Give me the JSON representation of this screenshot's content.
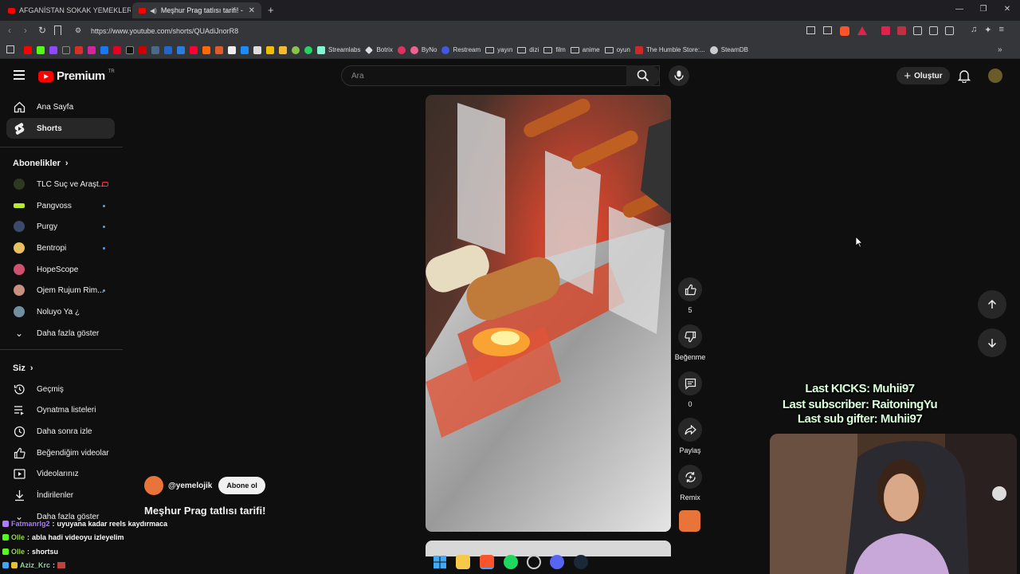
{
  "browser": {
    "tabs": [
      {
        "title": "AFGANİSTAN SOKAK YEMEKLERİNE"
      },
      {
        "title": "Meşhur Prag tatlısı tarifi! - Yo"
      }
    ],
    "new_tab": "+",
    "url": "https://www.youtube.com/shorts/QUAdiJnorR8",
    "bookmarks": [
      {
        "label": "Streamlabs",
        "type": "link"
      },
      {
        "label": "Botrix",
        "type": "link"
      },
      {
        "label": "ByNo",
        "type": "link"
      },
      {
        "label": "Restream",
        "type": "link"
      },
      {
        "label": "yayın",
        "type": "folder"
      },
      {
        "label": "dizi",
        "type": "folder"
      },
      {
        "label": "film",
        "type": "folder"
      },
      {
        "label": "anime",
        "type": "folder"
      },
      {
        "label": "oyun",
        "type": "folder"
      },
      {
        "label": "The Humble Store:...",
        "type": "link"
      },
      {
        "label": "SteamDB",
        "type": "link"
      }
    ]
  },
  "header": {
    "logo": "Premium",
    "logo_region": "TR",
    "search_placeholder": "Ara",
    "create_label": "Oluştur"
  },
  "sidebar": {
    "main": [
      {
        "label": "Ana Sayfa",
        "icon": "home-icon"
      },
      {
        "label": "Shorts",
        "icon": "shorts-icon",
        "active": true
      }
    ],
    "subscriptions_title": "Abonelikler",
    "subscriptions": [
      {
        "label": "TLC Suç ve Araşt...",
        "color": "#2d3a1f",
        "live": true
      },
      {
        "label": "Pangvoss",
        "color": "#b8e830",
        "dot": true
      },
      {
        "label": "Purgy",
        "color": "#3a4a6a",
        "dot": true
      },
      {
        "label": "Bentropi",
        "color": "#e8c060",
        "dot": true
      },
      {
        "label": "HopeScope",
        "color": "#d05070",
        "dot": false
      },
      {
        "label": "Ojem Rujum Rim...",
        "color": "#c89080",
        "dot": true
      },
      {
        "label": "Noluyo Ya ¿",
        "color": "#7090a0",
        "dot": false
      }
    ],
    "subs_more": "Daha fazla göster",
    "you_title": "Siz",
    "you_items": [
      {
        "label": "Geçmiş",
        "icon": "history-icon"
      },
      {
        "label": "Oynatma listeleri",
        "icon": "playlist-icon"
      },
      {
        "label": "Daha sonra izle",
        "icon": "clock-icon"
      },
      {
        "label": "Beğendiğim videolar",
        "icon": "like-icon"
      },
      {
        "label": "Videolarınız",
        "icon": "video-icon"
      },
      {
        "label": "İndirilenler",
        "icon": "download-icon"
      }
    ],
    "you_more": "Daha fazla göster"
  },
  "short": {
    "channel": "@yemelojik",
    "subscribe_label": "Abone ol",
    "title": "Meşhur Prag tatlısı tarifi!",
    "like_count": "5",
    "dislike_label": "Beğenme",
    "comment_count": "0",
    "share_label": "Paylaş",
    "remix_label": "Remix"
  },
  "overlay": {
    "lines": [
      "Last KICKS: Muhii97",
      "Last subscriber: RaitoningYu",
      "Last sub gifter: Muhii97"
    ]
  },
  "chat": [
    {
      "user": "Fatmanrlg2",
      "message": "uyuyana kadar reels kaydırmaca",
      "color": "#b07cff"
    },
    {
      "user": "Olle",
      "message": "abla hadi videoyu izleyelim",
      "color": "#9ad64a"
    },
    {
      "user": "Olle",
      "message": "shortsu",
      "color": "#9ad64a"
    },
    {
      "user": "Aziz_Krc",
      "message": "",
      "color": "#8ad6a0"
    }
  ],
  "colors": {
    "accent": "#ff0000",
    "link": "#3ea6ff",
    "overlay_text": "#d9ffd9"
  }
}
